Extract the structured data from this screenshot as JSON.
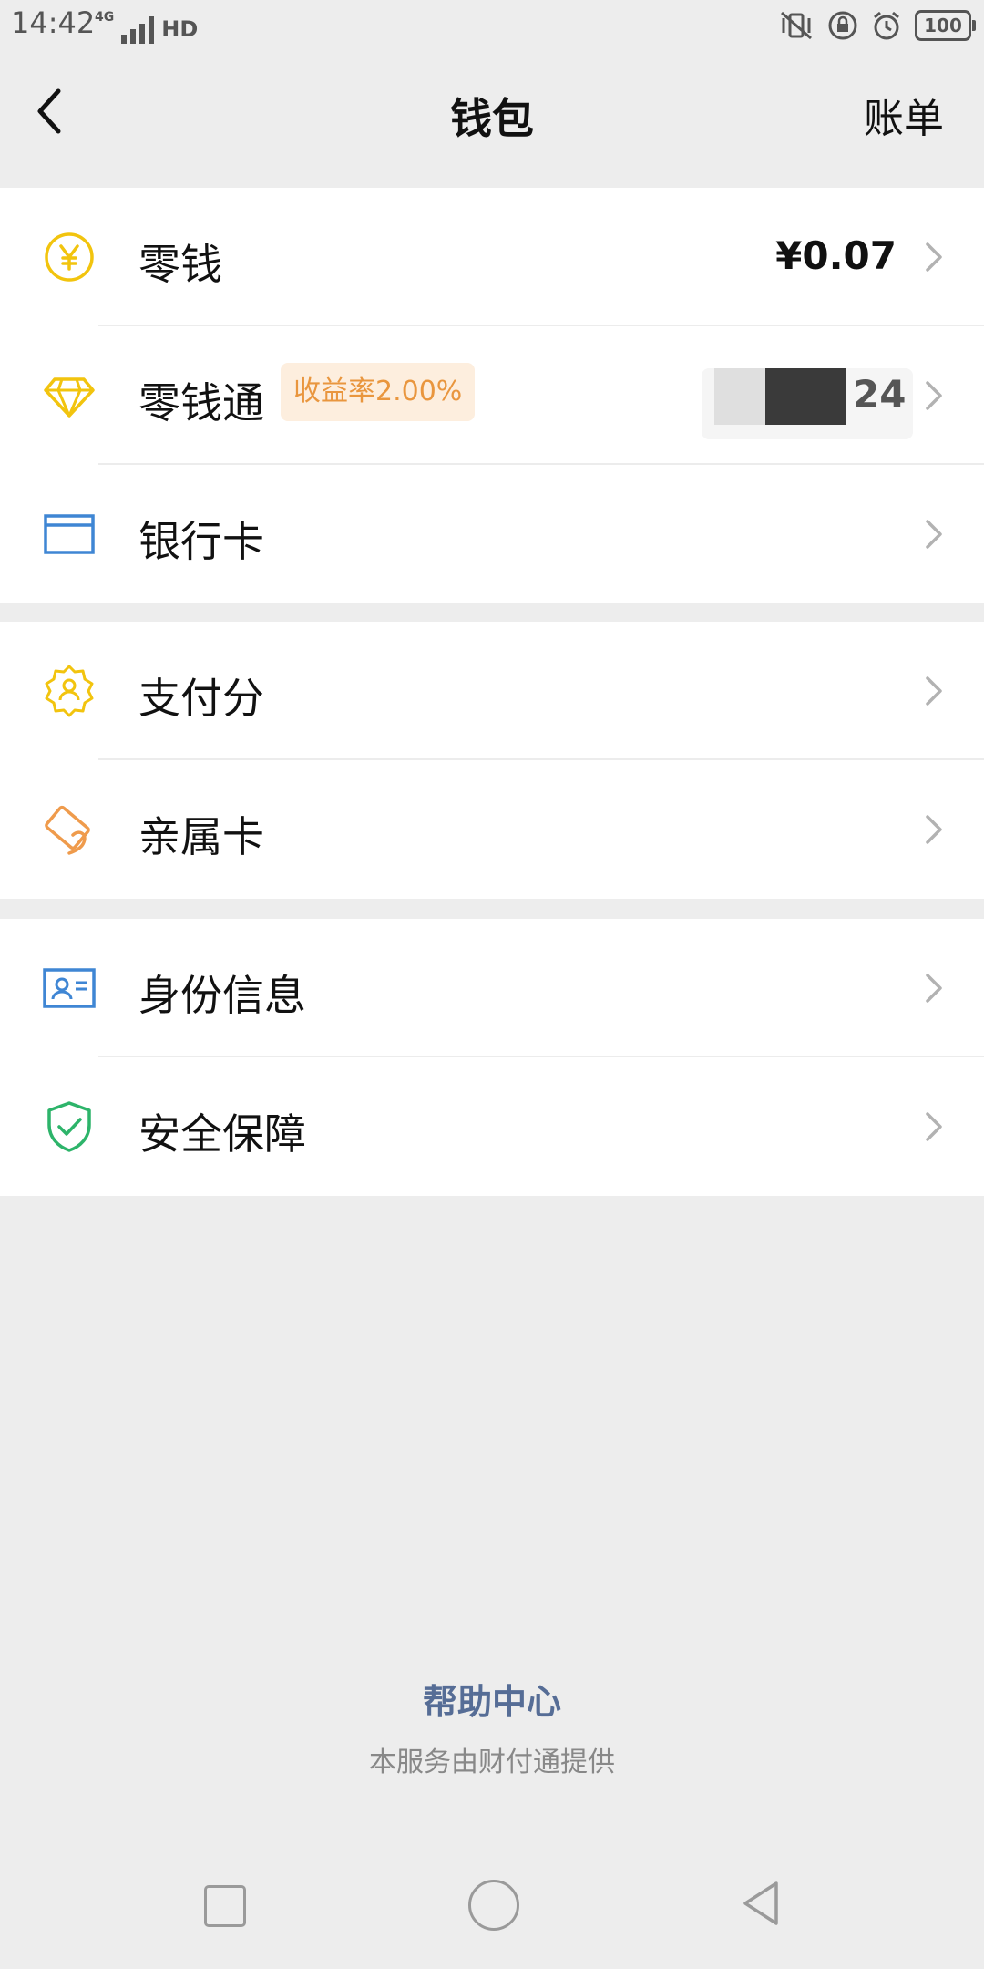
{
  "status_bar": {
    "time": "14:42",
    "network": "4G",
    "hd": "HD",
    "battery": "100"
  },
  "header": {
    "title": "钱包",
    "right_action": "账单",
    "back_icon": "chevron-left-icon"
  },
  "groups": [
    {
      "rows": [
        {
          "label": "零钱",
          "value": "¥0.07",
          "icon": "yuan-circle-icon",
          "color": "#f2c40e"
        },
        {
          "label": "零钱通",
          "badge": "收益率2.00%",
          "value_tail": "24",
          "icon": "diamond-icon",
          "color": "#f2c40e"
        },
        {
          "label": "银行卡",
          "icon": "card-icon",
          "color": "#3f86d4"
        }
      ]
    },
    {
      "rows": [
        {
          "label": "支付分",
          "icon": "badge-person-icon",
          "color": "#f2c40e"
        },
        {
          "label": "亲属卡",
          "icon": "family-card-icon",
          "color": "#ef9b4c"
        }
      ]
    },
    {
      "rows": [
        {
          "label": "身份信息",
          "icon": "id-card-icon",
          "color": "#3f86d4"
        },
        {
          "label": "安全保障",
          "icon": "shield-check-icon",
          "color": "#2db46a"
        }
      ]
    }
  ],
  "footer": {
    "help": "帮助中心",
    "provider": "本服务由财付通提供"
  }
}
